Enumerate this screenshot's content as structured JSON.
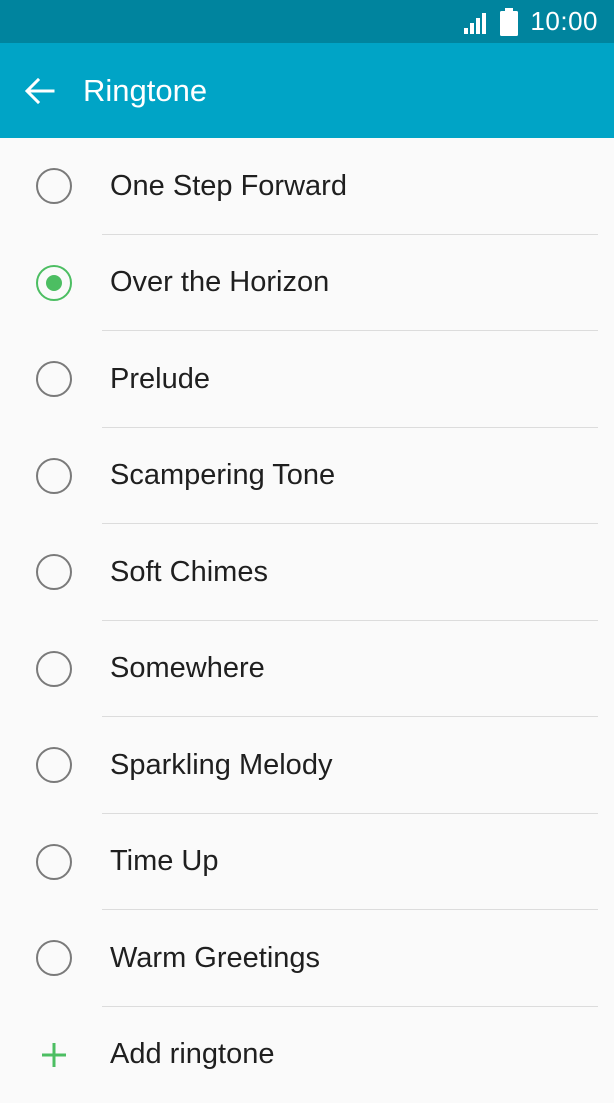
{
  "status_bar": {
    "time": "10:00",
    "signal_icon": "signal-icon",
    "battery_icon": "battery-icon"
  },
  "app_bar": {
    "back_icon": "back-arrow-icon",
    "title": "Ringtone"
  },
  "colors": {
    "status_bar": "#00849e",
    "app_bar": "#00a4c6",
    "accent": "#4cbe62",
    "background": "#fafafa"
  },
  "ringtones": [
    {
      "label": "One Step Forward",
      "selected": false
    },
    {
      "label": "Over the Horizon",
      "selected": true
    },
    {
      "label": "Prelude",
      "selected": false
    },
    {
      "label": "Scampering Tone",
      "selected": false
    },
    {
      "label": "Soft Chimes",
      "selected": false
    },
    {
      "label": "Somewhere",
      "selected": false
    },
    {
      "label": "Sparkling Melody",
      "selected": false
    },
    {
      "label": "Time Up",
      "selected": false
    },
    {
      "label": "Warm Greetings",
      "selected": false
    }
  ],
  "add_ringtone": {
    "icon": "plus-icon",
    "label": "Add ringtone"
  }
}
